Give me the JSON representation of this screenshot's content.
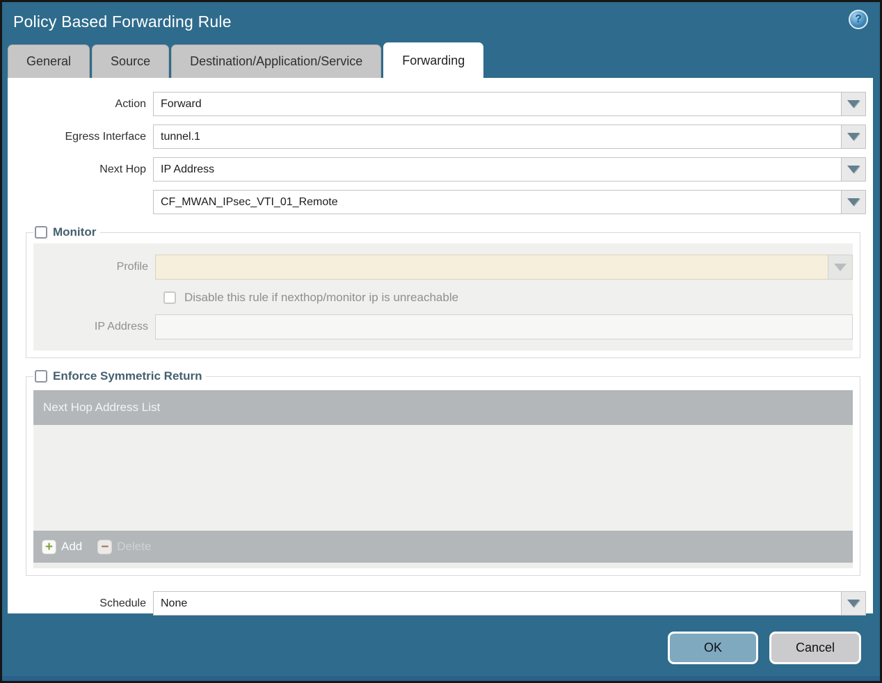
{
  "window": {
    "title": "Policy Based Forwarding Rule",
    "help_glyph": "?"
  },
  "tabs": [
    {
      "label": "General",
      "active": false
    },
    {
      "label": "Source",
      "active": false
    },
    {
      "label": "Destination/Application/Service",
      "active": false
    },
    {
      "label": "Forwarding",
      "active": true
    }
  ],
  "form": {
    "action_label": "Action",
    "action_value": "Forward",
    "egress_label": "Egress Interface",
    "egress_value": "tunnel.1",
    "next_hop_label": "Next Hop",
    "next_hop_value": "IP Address",
    "next_hop_address_value": "CF_MWAN_IPsec_VTI_01_Remote",
    "schedule_label": "Schedule",
    "schedule_value": "None"
  },
  "monitor": {
    "legend": "Monitor",
    "checked": false,
    "profile_label": "Profile",
    "profile_value": "",
    "disable_label": "Disable this rule if nexthop/monitor ip is unreachable",
    "disable_checked": false,
    "ip_label": "IP Address",
    "ip_value": ""
  },
  "symmetric": {
    "legend": "Enforce Symmetric Return",
    "checked": false,
    "table_header": "Next Hop Address List",
    "rows": [],
    "add_label": "Add",
    "add_glyph": "+",
    "delete_label": "Delete",
    "delete_glyph": "−"
  },
  "buttons": {
    "ok": "OK",
    "cancel": "Cancel"
  },
  "colors": {
    "titlebar_teal": "#2e6b8c",
    "tab_inactive_gray": "#c6c6c6",
    "tab_active_white": "#ffffff",
    "table_header_gray": "#b3b7b9",
    "disabled_panel_gray": "#f0f0ef",
    "profile_field_beige": "#f6efdb",
    "legend_text": "#44606f",
    "ok_button_blue": "#7fa9bf",
    "cancel_button_gray": "#cbcbce",
    "add_icon_green": "#7fa33c",
    "delete_icon_red": "#a96f62"
  }
}
